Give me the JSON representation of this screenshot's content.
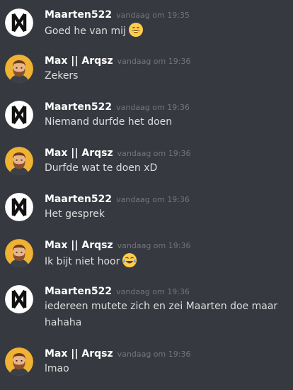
{
  "users": {
    "maarten": {
      "name": "Maarten522"
    },
    "max": {
      "name": "Max || Arqsz"
    }
  },
  "messages": [
    {
      "author": "Maarten522",
      "time": "vandaag om 19:35",
      "text": "Goed he van mij",
      "emoji": "grinning-face-icon"
    },
    {
      "author": "Max || Arqsz",
      "time": "vandaag om 19:36",
      "text": "Zekers"
    },
    {
      "author": "Maarten522",
      "time": "vandaag om 19:36",
      "text": "Niemand durfde het doen"
    },
    {
      "author": "Max || Arqsz",
      "time": "vandaag om 19:36",
      "text": "Durfde wat te doen xD"
    },
    {
      "author": "Maarten522",
      "time": "vandaag om 19:36",
      "text": "Het gesprek"
    },
    {
      "author": "Max || Arqsz",
      "time": "vandaag om 19:36",
      "text": "Ik bijt niet hoor",
      "emoji": "joy-face-icon"
    },
    {
      "author": "Maarten522",
      "time": "vandaag om 19:36",
      "text": "iedereen mutete zich en zei Maarten doe maar hahaha"
    },
    {
      "author": "Max || Arqsz",
      "time": "vandaag om 19:36",
      "text": "lmao"
    }
  ],
  "colors": {
    "background": "#36393f",
    "author": "#ffffff",
    "timestamp": "#72767d",
    "text": "#dcddde",
    "avatar_max_bg": "#f0b232"
  }
}
